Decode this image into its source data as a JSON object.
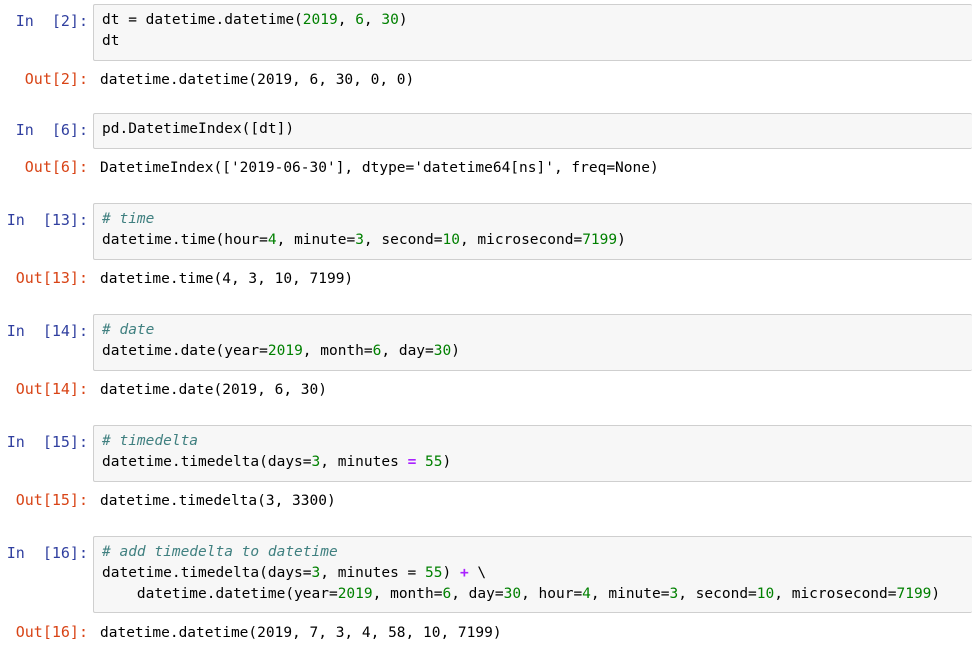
{
  "cells": [
    {
      "in_prompt": "In  [2]:",
      "code_lines": [
        [
          {
            "t": "dt = datetime.datetime("
          },
          {
            "t": "2019",
            "c": "num"
          },
          {
            "t": ", "
          },
          {
            "t": "6",
            "c": "num"
          },
          {
            "t": ", "
          },
          {
            "t": "30",
            "c": "num"
          },
          {
            "t": ")"
          }
        ],
        [
          {
            "t": "dt"
          }
        ]
      ],
      "out_prompt": "Out[2]:",
      "output": "datetime.datetime(2019, 6, 30, 0, 0)"
    },
    {
      "in_prompt": "In  [6]:",
      "code_lines": [
        [
          {
            "t": "pd.DatetimeIndex([dt])"
          }
        ]
      ],
      "out_prompt": "Out[6]:",
      "output": "DatetimeIndex(['2019-06-30'], dtype='datetime64[ns]', freq=None)"
    },
    {
      "in_prompt": "In  [13]:",
      "code_lines": [
        [
          {
            "t": "# time",
            "c": "cm"
          }
        ],
        [
          {
            "t": "datetime.time(hour="
          },
          {
            "t": "4",
            "c": "num"
          },
          {
            "t": ", minute="
          },
          {
            "t": "3",
            "c": "num"
          },
          {
            "t": ", second="
          },
          {
            "t": "10",
            "c": "num"
          },
          {
            "t": ", microsecond="
          },
          {
            "t": "7199",
            "c": "num"
          },
          {
            "t": ")"
          }
        ]
      ],
      "out_prompt": "Out[13]:",
      "output": "datetime.time(4, 3, 10, 7199)"
    },
    {
      "in_prompt": "In  [14]:",
      "code_lines": [
        [
          {
            "t": "# date",
            "c": "cm"
          }
        ],
        [
          {
            "t": "datetime.date(year="
          },
          {
            "t": "2019",
            "c": "num"
          },
          {
            "t": ", month="
          },
          {
            "t": "6",
            "c": "num"
          },
          {
            "t": ", day="
          },
          {
            "t": "30",
            "c": "num"
          },
          {
            "t": ")"
          }
        ]
      ],
      "out_prompt": "Out[14]:",
      "output": "datetime.date(2019, 6, 30)"
    },
    {
      "in_prompt": "In  [15]:",
      "code_lines": [
        [
          {
            "t": "# timedelta",
            "c": "cm"
          }
        ],
        [
          {
            "t": "datetime.timedelta(days="
          },
          {
            "t": "3",
            "c": "num"
          },
          {
            "t": ", minutes "
          },
          {
            "t": "= ",
            "c": "op"
          },
          {
            "t": "55",
            "c": "num"
          },
          {
            "t": ")"
          }
        ]
      ],
      "out_prompt": "Out[15]:",
      "output": "datetime.timedelta(3, 3300)"
    },
    {
      "in_prompt": "In  [16]:",
      "code_lines": [
        [
          {
            "t": "# add timedelta to datetime",
            "c": "cm"
          }
        ],
        [
          {
            "t": "datetime.timedelta(days="
          },
          {
            "t": "3",
            "c": "num"
          },
          {
            "t": ", minutes = "
          },
          {
            "t": "55",
            "c": "num"
          },
          {
            "t": ") "
          },
          {
            "t": "+",
            "c": "op"
          },
          {
            "t": " \\"
          }
        ],
        [
          {
            "t": "    datetime.datetime(year="
          },
          {
            "t": "2019",
            "c": "num"
          },
          {
            "t": ", month="
          },
          {
            "t": "6",
            "c": "num"
          },
          {
            "t": ", day="
          },
          {
            "t": "30",
            "c": "num"
          },
          {
            "t": ", hour="
          },
          {
            "t": "4",
            "c": "num"
          },
          {
            "t": ", minute="
          },
          {
            "t": "3",
            "c": "num"
          },
          {
            "t": ", second="
          },
          {
            "t": "10",
            "c": "num"
          },
          {
            "t": ", microsecond="
          },
          {
            "t": "7199",
            "c": "num"
          },
          {
            "t": ")"
          }
        ]
      ],
      "out_prompt": "Out[16]:",
      "output": "datetime.datetime(2019, 7, 3, 4, 58, 10, 7199)"
    }
  ]
}
